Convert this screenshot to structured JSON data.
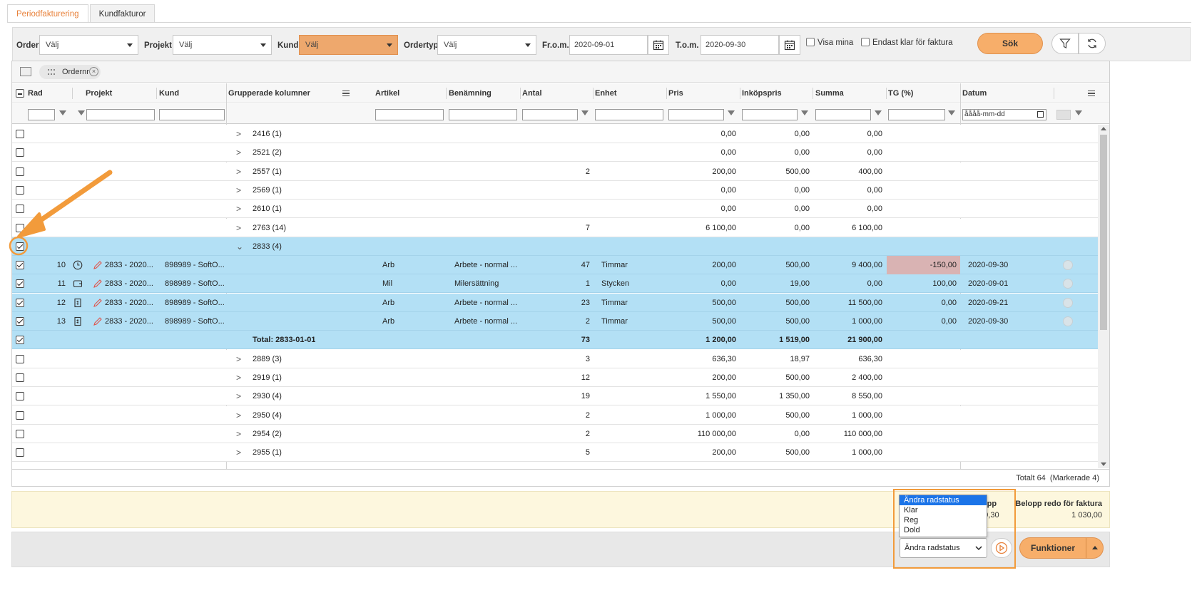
{
  "tabs": [
    {
      "label": "Periodfakturering",
      "active": true
    },
    {
      "label": "Kundfakturor",
      "active": false
    }
  ],
  "filters": {
    "order_label": "Order",
    "order_value": "Välj",
    "projekt_label": "Projekt",
    "projekt_value": "Välj",
    "kund_label": "Kund",
    "kund_value": "Välj",
    "ordertyp_label": "Ordertyp",
    "ordertyp_value": "Välj",
    "from_label": "Fr.o.m.",
    "from_value": "2020-09-01",
    "tom_label": "T.o.m.",
    "tom_value": "2020-09-30",
    "visa_mina_label": "Visa mina",
    "endast_klar_label": "Endast klar för faktura",
    "search_label": "Sök"
  },
  "grid": {
    "group_pill": "Ordernr",
    "columns": {
      "rad": "Rad",
      "projekt": "Projekt",
      "kund": "Kund",
      "grupperade": "Grupperade kolumner",
      "artikel": "Artikel",
      "benamning": "Benämning",
      "antal": "Antal",
      "enhet": "Enhet",
      "pris": "Pris",
      "inkopspris": "Inköpspris",
      "summa": "Summa",
      "tg": "TG (%)",
      "datum": "Datum"
    },
    "date_filter_placeholder": "åååå-mm-dd",
    "rows": [
      {
        "type": "group",
        "expander": ">",
        "group": "2416 (1)",
        "antal": "",
        "pris": "0,00",
        "inkop": "0,00",
        "summa": "0,00",
        "checked": false
      },
      {
        "type": "group",
        "expander": ">",
        "group": "2521 (2)",
        "antal": "",
        "pris": "0,00",
        "inkop": "0,00",
        "summa": "0,00",
        "checked": false
      },
      {
        "type": "group",
        "expander": ">",
        "group": "2557 (1)",
        "antal": "2",
        "pris": "200,00",
        "inkop": "500,00",
        "summa": "400,00",
        "checked": false
      },
      {
        "type": "group",
        "expander": ">",
        "group": "2569 (1)",
        "antal": "",
        "pris": "0,00",
        "inkop": "0,00",
        "summa": "0,00",
        "checked": false
      },
      {
        "type": "group",
        "expander": ">",
        "group": "2610 (1)",
        "antal": "",
        "pris": "0,00",
        "inkop": "0,00",
        "summa": "0,00",
        "checked": false
      },
      {
        "type": "group",
        "expander": ">",
        "group": "2763 (14)",
        "antal": "7",
        "pris": "6 100,00",
        "inkop": "0,00",
        "summa": "6 100,00",
        "checked": false
      },
      {
        "type": "group-open",
        "expander": "⌄",
        "group": "2833 (4)",
        "checked": true
      },
      {
        "type": "detail",
        "rad": "10",
        "icon": "clock-icon",
        "projekt": "2833 - 2020...",
        "kund": "898989 - SoftO...",
        "artikel": "Arb",
        "benamning": "Arbete - normal ...",
        "antal": "47",
        "enhet": "Timmar",
        "pris": "200,00",
        "inkop": "500,00",
        "summa": "9 400,00",
        "tg": "-150,00",
        "tgneg": true,
        "datum": "2020-09-30",
        "checked": true
      },
      {
        "type": "detail",
        "rad": "11",
        "icon": "wallet-icon",
        "projekt": "2833 - 2020...",
        "kund": "898989 - SoftO...",
        "artikel": "Mil",
        "benamning": "Milersättning",
        "antal": "1",
        "enhet": "Stycken",
        "pris": "0,00",
        "inkop": "19,00",
        "summa": "0,00",
        "tg": "100,00",
        "tgneg": false,
        "datum": "2020-09-01",
        "checked": true
      },
      {
        "type": "detail",
        "rad": "12",
        "icon": "invoice-icon",
        "projekt": "2833 - 2020...",
        "kund": "898989 - SoftO...",
        "artikel": "Arb",
        "benamning": "Arbete - normal ...",
        "antal": "23",
        "enhet": "Timmar",
        "pris": "500,00",
        "inkop": "500,00",
        "summa": "11 500,00",
        "tg": "0,00",
        "tgneg": false,
        "datum": "2020-09-21",
        "checked": true
      },
      {
        "type": "detail",
        "rad": "13",
        "icon": "invoice-icon",
        "projekt": "2833 - 2020...",
        "kund": "898989 - SoftO...",
        "artikel": "Arb",
        "benamning": "Arbete - normal ...",
        "antal": "2",
        "enhet": "Timmar",
        "pris": "500,00",
        "inkop": "500,00",
        "summa": "1 000,00",
        "tg": "0,00",
        "tgneg": false,
        "datum": "2020-09-30",
        "checked": true
      },
      {
        "type": "total",
        "group": "Total: 2833-01-01",
        "antal": "73",
        "pris": "1 200,00",
        "inkop": "1 519,00",
        "summa": "21 900,00",
        "checked": true
      },
      {
        "type": "group",
        "expander": ">",
        "group": "2889 (3)",
        "antal": "3",
        "pris": "636,30",
        "inkop": "18,97",
        "summa": "636,30",
        "checked": false
      },
      {
        "type": "group",
        "expander": ">",
        "group": "2919 (1)",
        "antal": "12",
        "pris": "200,00",
        "inkop": "500,00",
        "summa": "2 400,00",
        "checked": false
      },
      {
        "type": "group",
        "expander": ">",
        "group": "2930 (4)",
        "antal": "19",
        "pris": "1 550,00",
        "inkop": "1 350,00",
        "summa": "8 550,00",
        "checked": false
      },
      {
        "type": "group",
        "expander": ">",
        "group": "2950 (4)",
        "antal": "2",
        "pris": "1 000,00",
        "inkop": "500,00",
        "summa": "1 000,00",
        "checked": false
      },
      {
        "type": "group",
        "expander": ">",
        "group": "2954 (2)",
        "antal": "2",
        "pris": "110 000,00",
        "inkop": "0,00",
        "summa": "110 000,00",
        "checked": false
      },
      {
        "type": "group",
        "expander": ">",
        "group": "2955 (1)",
        "antal": "5",
        "pris": "200,00",
        "inkop": "500,00",
        "summa": "1 000,00",
        "checked": false
      }
    ],
    "footer": "Totalt 64  (Markerade 4)"
  },
  "summary": {
    "col1_title": "belopp",
    "col1_value": "529,30",
    "col2_title": "Belopp redo för faktura",
    "col2_value": "1 030,00"
  },
  "actions": {
    "dropdown_options": [
      "Ändra radstatus",
      "Klar",
      "Reg",
      "Dold"
    ],
    "select_value": "Ändra radstatus",
    "funktioner_label": "Funktioner"
  },
  "colors": {
    "accent": "#f7ae6a",
    "selected_row": "#b3e0f5",
    "highlight": "#f29b3b",
    "tab_active": "#e8813a"
  }
}
